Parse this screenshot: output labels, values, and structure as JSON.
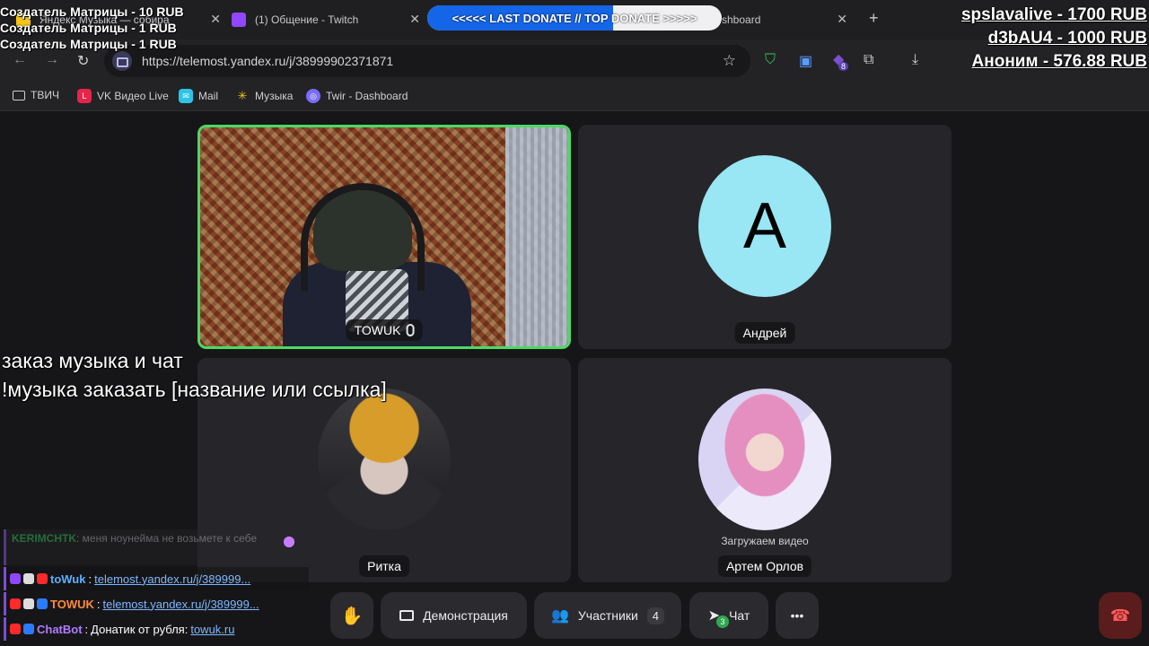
{
  "browser": {
    "tabs": [
      {
        "label": "Яндекс Музыка — собира"
      },
      {
        "label": "(1) Общение - Twitch"
      },
      {
        "label": "shboard"
      }
    ],
    "new_tab": "+",
    "close": "✕",
    "url": "https://telemost.yandex.ru/j/38999902371871",
    "extension_badge": "8",
    "bookmarks": [
      {
        "label": "ТВИЧ",
        "icon": "folder-icon"
      },
      {
        "label": "VK Видео Live",
        "icon": "vk-live-icon"
      },
      {
        "label": "Mail",
        "icon": "mail-icon"
      },
      {
        "label": "Музыка",
        "icon": "music-icon"
      },
      {
        "label": "Twir - Dashboard",
        "icon": "twir-icon"
      }
    ]
  },
  "meeting": {
    "participants": [
      {
        "name": "TOWUK",
        "type": "video",
        "speaking": true
      },
      {
        "name": "Андрей",
        "type": "letter",
        "letter": "А",
        "color": "#99e6f4"
      },
      {
        "name": "Ритка",
        "type": "photo"
      },
      {
        "name": "Артем Орлов",
        "type": "photo",
        "status": "Загружаем видео"
      }
    ],
    "controls": {
      "demo_label": "Демонстрация",
      "participants_label": "Участники",
      "participants_count": "4",
      "chat_label": "Чат",
      "chat_badge": "3",
      "more_label": "•••"
    }
  },
  "overlay": {
    "donors": [
      "Создатель Матрицы - 10 RUB",
      "Создатель Матрицы - 1 RUB",
      "Создатель Матрицы - 1 RUB"
    ],
    "donate_bar": {
      "text": "<<<<< LAST DONATE // TOP DONATE >>>>>",
      "progress": 0.63
    },
    "top_donors": [
      "spslavalive - 1700 RUB",
      "d3bAU4 - 1000 RUB",
      "Аноним - 576.88 RUB"
    ],
    "music_info": [
      "заказ музыка и чат",
      "!музыка заказать [название или ссылка]"
    ],
    "chat": {
      "faded_author": "KERIMCHTK",
      "faded_text": "меня ноунейма не возьмете к себе",
      "messages": [
        {
          "author": "toWuk",
          "text": "telemost.yandex.ru/j/389999..."
        },
        {
          "author": "TOWUK",
          "text": "telemost.yandex.ru/j/389999..."
        },
        {
          "author": "ChatBot",
          "text": "Донатик от рубля: ",
          "link": "towuk.ru"
        }
      ]
    }
  }
}
